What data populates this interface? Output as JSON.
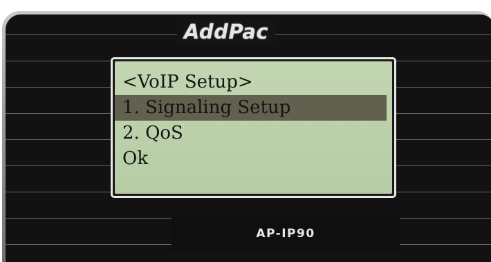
{
  "brand": "AddPac",
  "model": "AP-IP90",
  "lcd": {
    "title": "<VoIP Setup>",
    "menu_items": [
      {
        "label": "1. Signaling Setup",
        "selected": true
      },
      {
        "label": "2. QoS",
        "selected": false
      }
    ],
    "softkey": "Ok"
  },
  "colors": {
    "lcd_background": "#b6cca4",
    "lcd_highlight": "#62614f",
    "panel": "#141414"
  }
}
